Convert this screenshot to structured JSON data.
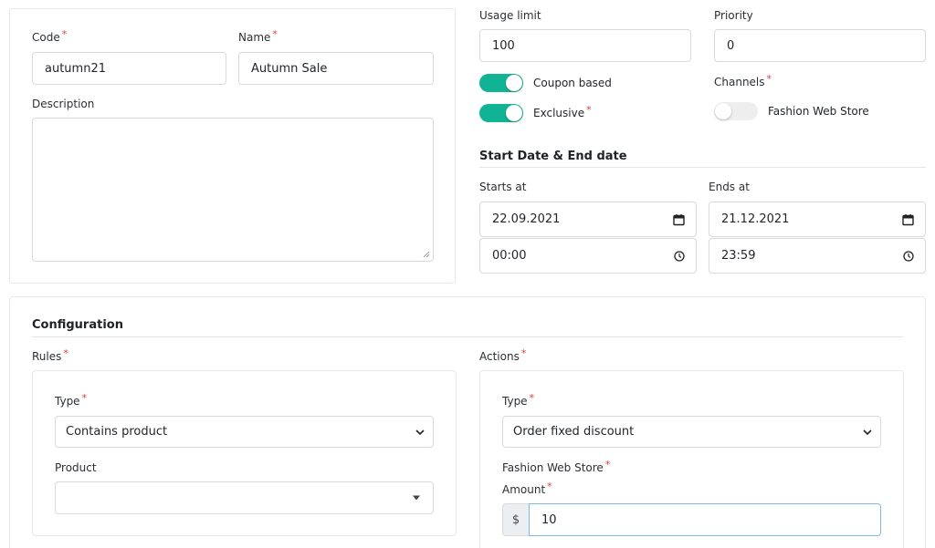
{
  "general": {
    "code_label": "Code",
    "code_value": "autumn21",
    "name_label": "Name",
    "name_value": "Autumn Sale",
    "description_label": "Description",
    "description_value": ""
  },
  "settings": {
    "usage_limit_label": "Usage limit",
    "usage_limit_value": "100",
    "priority_label": "Priority",
    "priority_value": "0",
    "coupon_based_label": "Coupon based",
    "coupon_based_on": true,
    "exclusive_label": "Exclusive",
    "exclusive_on": true,
    "channels_label": "Channels",
    "channel_fashion_label": "Fashion Web Store",
    "channel_fashion_on": false
  },
  "dates": {
    "heading": "Start Date & End date",
    "starts_label": "Starts at",
    "start_date": "22.09.2021",
    "start_time": "00:00",
    "ends_label": "Ends at",
    "end_date": "21.12.2021",
    "end_time": "23:59"
  },
  "configuration": {
    "heading": "Configuration",
    "rules_label": "Rules",
    "rule_type_label": "Type",
    "rule_type_value": "Contains product",
    "product_label": "Product",
    "product_value": "",
    "actions_label": "Actions",
    "action_type_label": "Type",
    "action_type_value": "Order fixed discount",
    "channel_label": "Fashion Web Store",
    "amount_label": "Amount",
    "currency_symbol": "$",
    "amount_value": "10"
  },
  "required_mark": "*",
  "colors": {
    "toggle_on": "#10b394",
    "toggle_off": "#eeeeee",
    "required": "#e23d3d",
    "focus_border": "#7fb8e0"
  }
}
